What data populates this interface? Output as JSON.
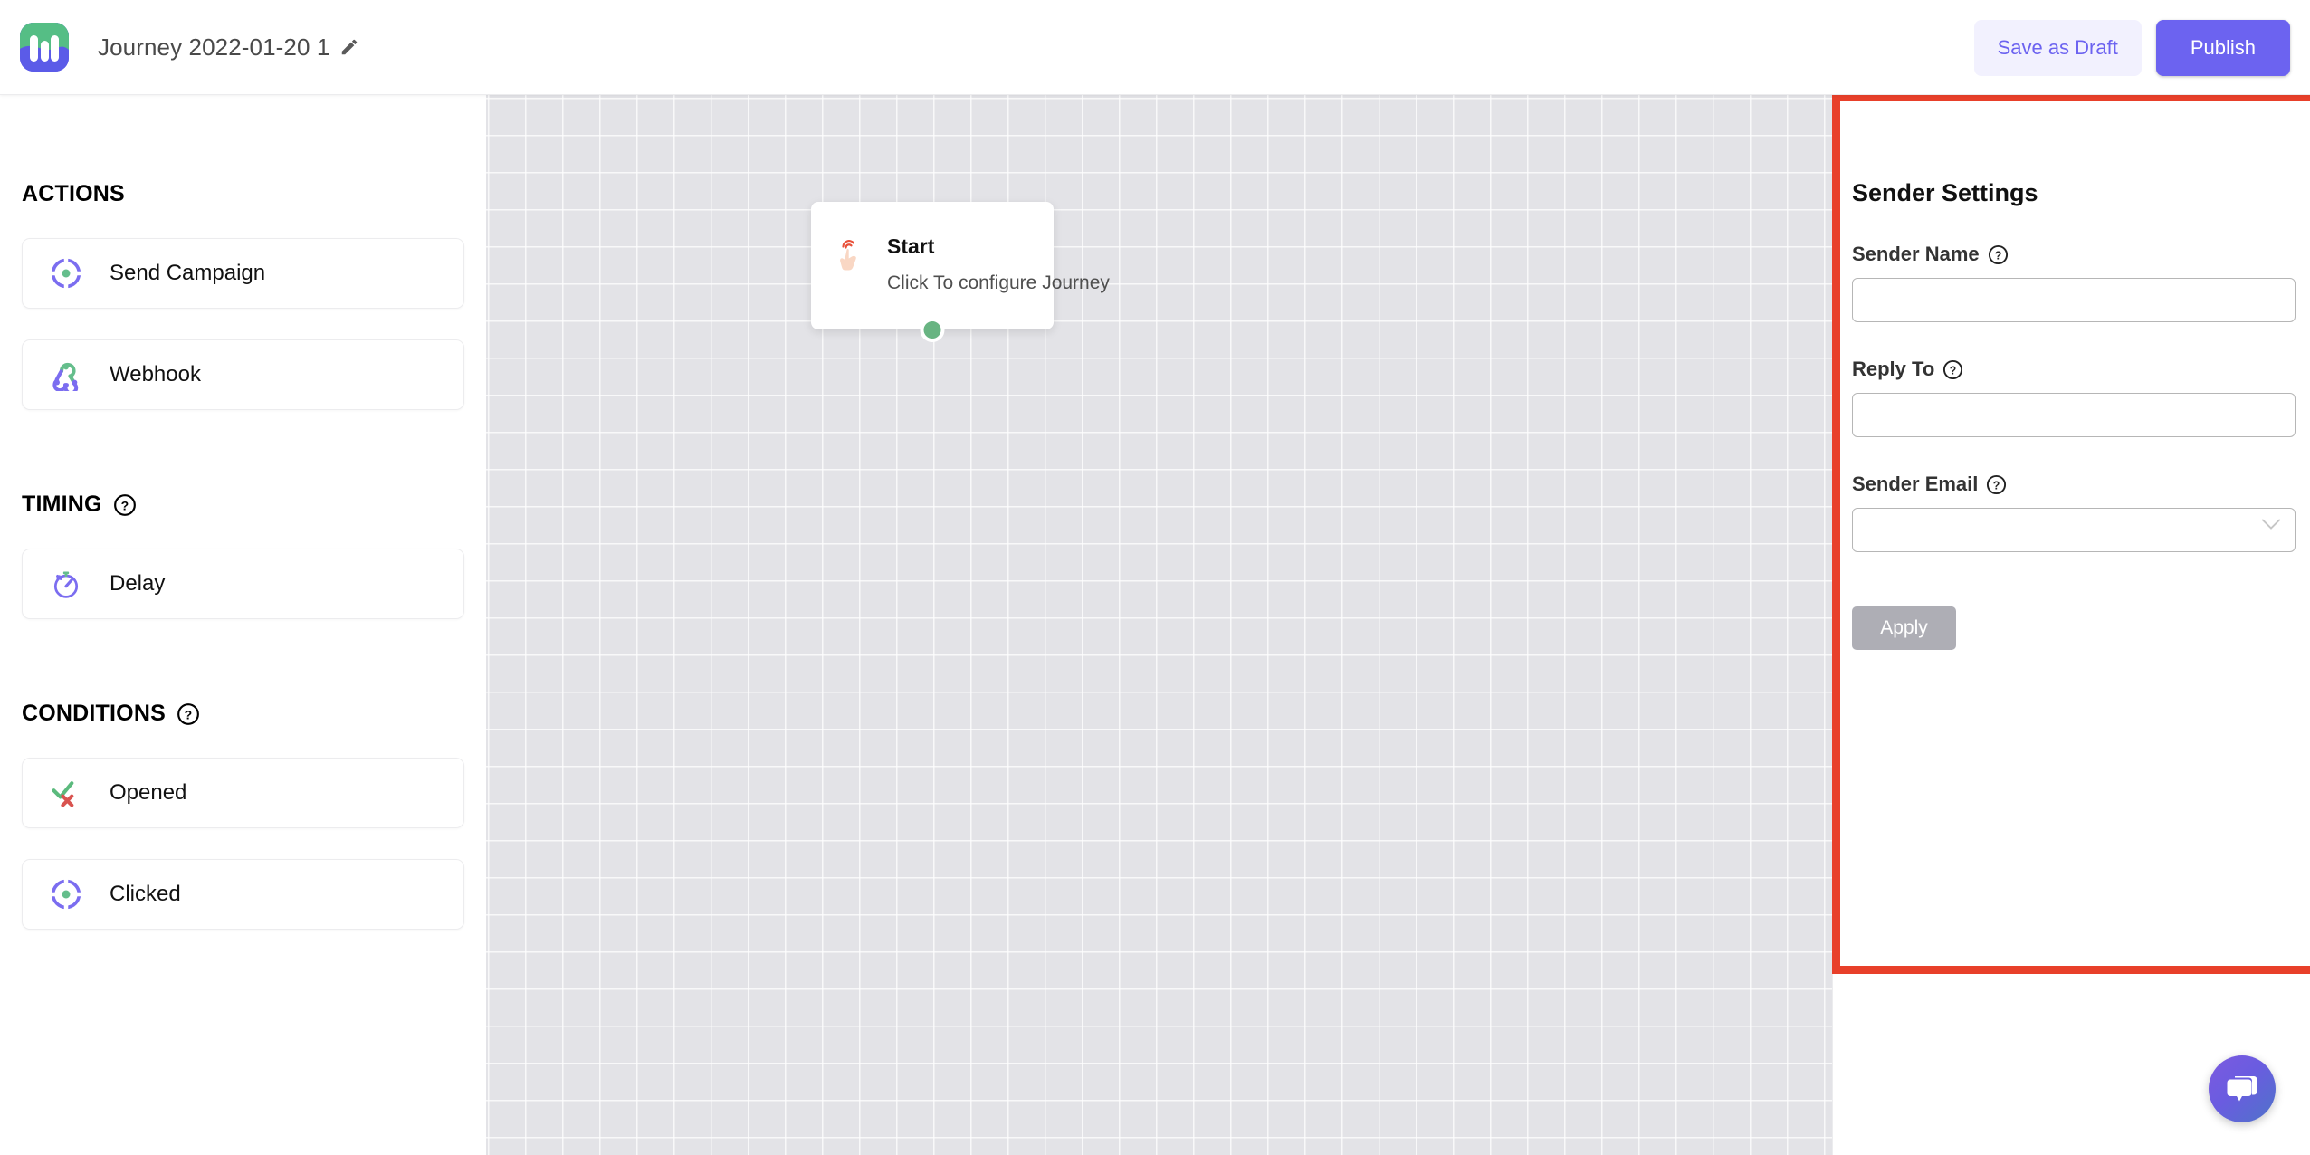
{
  "header": {
    "logo_icon": "app-logo-icon",
    "journey_title": "Journey 2022-01-20 1",
    "edit_icon": "pencil-icon",
    "save_draft_label": "Save as Draft",
    "publish_label": "Publish",
    "colors": {
      "publish_bg": "#6c63f0",
      "draft_bg": "#f2f1fe",
      "draft_text": "#6c63f0"
    }
  },
  "sidebar": {
    "sections": [
      {
        "title": "ACTIONS",
        "has_help": false,
        "items": [
          {
            "label": "Send Campaign",
            "icon": "target-icon"
          },
          {
            "label": "Webhook",
            "icon": "webhook-icon"
          }
        ]
      },
      {
        "title": "TIMING",
        "has_help": true,
        "help_icon": "question-circle-icon",
        "items": [
          {
            "label": "Delay",
            "icon": "stopwatch-icon"
          }
        ]
      },
      {
        "title": "CONDITIONS",
        "has_help": true,
        "help_icon": "question-circle-icon",
        "items": [
          {
            "label": "Opened",
            "icon": "check-cross-icon"
          },
          {
            "label": "Clicked",
            "icon": "target-icon"
          }
        ]
      }
    ]
  },
  "canvas": {
    "background_color": "#e3e3e7",
    "grid_size": 41,
    "start_node": {
      "icon": "tap-hand-icon",
      "title": "Start",
      "subtitle": "Click To configure Journey",
      "handle_color": "#68b482"
    }
  },
  "right_panel": {
    "heading": "Sender Settings",
    "highlight_color": "#e8402a",
    "fields": [
      {
        "label": "Sender Name",
        "help_icon": "question-circle-icon",
        "type": "text",
        "value": "",
        "placeholder": ""
      },
      {
        "label": "Reply To",
        "help_icon": "question-circle-icon",
        "type": "text",
        "value": "",
        "placeholder": ""
      },
      {
        "label": "Sender Email",
        "help_icon": "question-circle-icon",
        "type": "select",
        "value": "",
        "placeholder": "",
        "chevron_icon": "chevron-down-icon"
      }
    ],
    "apply_label": "Apply",
    "apply_disabled": true
  },
  "chat_widget": {
    "icon": "chat-bubbles-icon",
    "gradient_from": "#7c5adf",
    "gradient_to": "#4f73c9"
  }
}
